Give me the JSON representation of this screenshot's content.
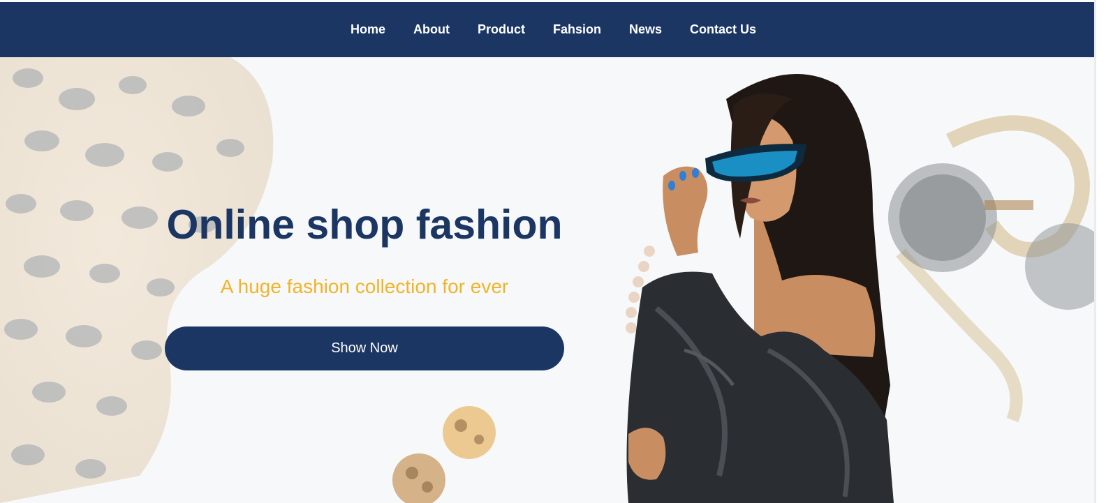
{
  "nav": {
    "items": [
      {
        "label": "Home"
      },
      {
        "label": "About"
      },
      {
        "label": "Product"
      },
      {
        "label": "Fahsion"
      },
      {
        "label": "News"
      },
      {
        "label": "Contact Us"
      }
    ]
  },
  "hero": {
    "title": "Online shop fashion",
    "subtitle": "A huge fashion collection for ever",
    "cta_label": "Show Now"
  },
  "colors": {
    "navy": "#1b3663",
    "accent_yellow": "#f0b429",
    "white": "#ffffff"
  },
  "images": {
    "background": "fashion-accessories-background",
    "model": "model-with-sunglasses-photo"
  }
}
